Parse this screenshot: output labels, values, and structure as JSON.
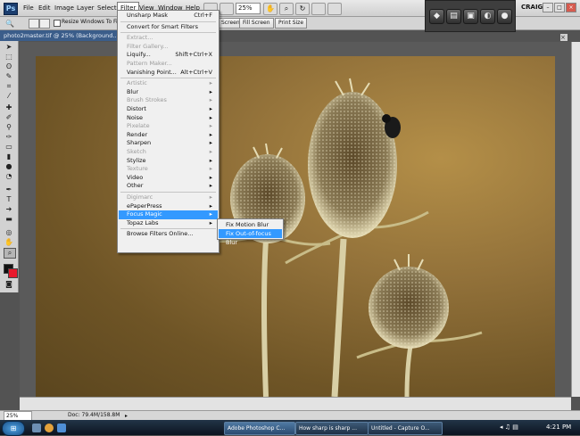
{
  "menubar": {
    "logo": "Ps",
    "items": [
      "File",
      "Edit",
      "Image",
      "Layer",
      "Select",
      "Filter",
      "View",
      "Window",
      "Help"
    ],
    "zoom": "25%",
    "user": "CRAIG",
    "window_controls": [
      "–",
      "□",
      "×"
    ]
  },
  "options_bar": {
    "resize_label": "Resize Windows To Fit",
    "buttons": [
      "Screen",
      "Fill Screen",
      "Print Size"
    ]
  },
  "document": {
    "tab_title": "photo2master.tif @ 25% (Background..."
  },
  "filter_menu": {
    "items": [
      {
        "label": "Unsharp Mask",
        "shortcut": "Ctrl+F",
        "state": "normal"
      },
      {
        "sep": true
      },
      {
        "label": "Convert for Smart Filters",
        "state": "normal"
      },
      {
        "sep": true
      },
      {
        "label": "Extract...",
        "state": "disabled"
      },
      {
        "label": "Filter Gallery...",
        "state": "disabled"
      },
      {
        "label": "Liquify...",
        "shortcut": "Shift+Ctrl+X",
        "state": "normal"
      },
      {
        "label": "Pattern Maker...",
        "state": "disabled"
      },
      {
        "label": "Vanishing Point...",
        "shortcut": "Alt+Ctrl+V",
        "state": "normal"
      },
      {
        "sep": true
      },
      {
        "label": "Artistic",
        "arrow": "▸",
        "state": "disabled"
      },
      {
        "label": "Blur",
        "arrow": "▸",
        "state": "normal"
      },
      {
        "label": "Brush Strokes",
        "arrow": "▸",
        "state": "disabled"
      },
      {
        "label": "Distort",
        "arrow": "▸",
        "state": "normal"
      },
      {
        "label": "Noise",
        "arrow": "▸",
        "state": "normal"
      },
      {
        "label": "Pixelate",
        "arrow": "▸",
        "state": "disabled"
      },
      {
        "label": "Render",
        "arrow": "▸",
        "state": "normal"
      },
      {
        "label": "Sharpen",
        "arrow": "▸",
        "state": "normal"
      },
      {
        "label": "Sketch",
        "arrow": "▸",
        "state": "disabled"
      },
      {
        "label": "Stylize",
        "arrow": "▸",
        "state": "normal"
      },
      {
        "label": "Texture",
        "arrow": "▸",
        "state": "disabled"
      },
      {
        "label": "Video",
        "arrow": "▸",
        "state": "normal"
      },
      {
        "label": "Other",
        "arrow": "▸",
        "state": "normal"
      },
      {
        "sep": true
      },
      {
        "label": "Digimarc",
        "arrow": "▸",
        "state": "disabled"
      },
      {
        "label": "ePaperPress",
        "arrow": "▸",
        "state": "normal"
      },
      {
        "label": "Focus Magic",
        "arrow": "▸",
        "state": "highlighted"
      },
      {
        "label": "Topaz Labs",
        "arrow": "▸",
        "state": "normal"
      },
      {
        "sep": true
      },
      {
        "label": "Browse Filters Online...",
        "state": "normal"
      }
    ]
  },
  "submenu": {
    "items": [
      {
        "label": "Fix Motion Blur",
        "state": "normal"
      },
      {
        "label": "Fix Out-of-focus Blur",
        "state": "highlighted"
      }
    ]
  },
  "statusbar": {
    "zoom": "25%",
    "doc": "Doc: 79.4M/158.8M"
  },
  "taskbar": {
    "tasks": [
      "Adobe Photoshop C...",
      "How sharp is sharp ...",
      "Untitled - Capture O..."
    ],
    "clock": "4:21 PM"
  },
  "colors": {
    "highlight": "#3399ff",
    "foreground": "#111111",
    "background": "#e8192c"
  }
}
